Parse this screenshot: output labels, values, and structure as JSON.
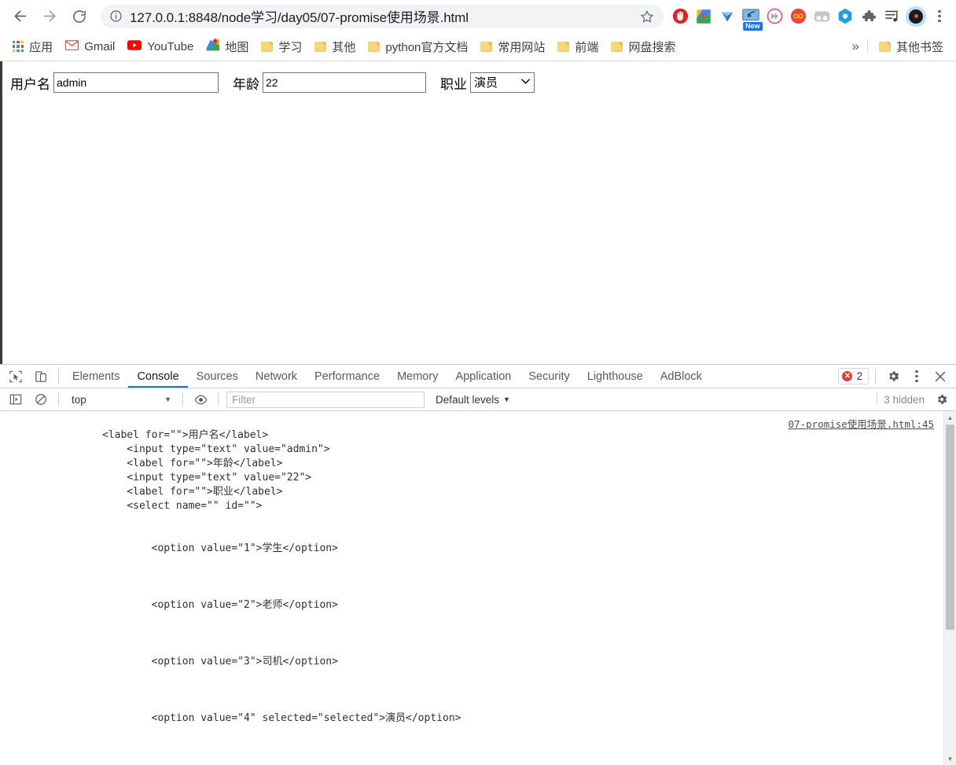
{
  "browser": {
    "nav": {
      "back": "Back",
      "forward": "Forward",
      "reload": "Reload"
    },
    "omnibox": {
      "url": "127.0.0.1:8848/node学习/day05/07-promise使用场景.html",
      "info_tooltip": "View site information",
      "star_tooltip": "Bookmark this tab"
    },
    "extensions": [
      {
        "name": "adblock-extension-icon",
        "label": "AdBlock"
      },
      {
        "name": "google-translate-extension-icon",
        "label": "Translate"
      },
      {
        "name": "v-extension-icon",
        "label": "V"
      },
      {
        "name": "screenshot-extension-icon",
        "label": "Screenshot",
        "badge": "New"
      },
      {
        "name": "fast-forward-extension-icon",
        "label": "Fast Forward"
      },
      {
        "name": "infinity-extension-icon",
        "label": "Infinity"
      },
      {
        "name": "goggles-extension-icon",
        "label": "Goggles"
      },
      {
        "name": "hexagon-extension-icon",
        "label": "Hexagon"
      },
      {
        "name": "puzzle-extensions-icon",
        "label": "Extensions"
      },
      {
        "name": "playlist-icon",
        "label": "Playlist"
      }
    ],
    "profile": {
      "name": "profile-avatar"
    },
    "menu": {
      "name": "chrome-menu-button"
    }
  },
  "bookmarks": {
    "items": [
      {
        "label": "应用",
        "icon": "apps-grid-icon"
      },
      {
        "label": "Gmail",
        "icon": "gmail-icon"
      },
      {
        "label": "YouTube",
        "icon": "youtube-icon"
      },
      {
        "label": "地图",
        "icon": "maps-icon"
      },
      {
        "label": "学习",
        "icon": "folder-icon"
      },
      {
        "label": "其他",
        "icon": "folder-icon"
      },
      {
        "label": "python官方文档",
        "icon": "folder-icon"
      },
      {
        "label": "常用网站",
        "icon": "folder-icon"
      },
      {
        "label": "前端",
        "icon": "folder-icon"
      },
      {
        "label": "网盘搜索",
        "icon": "folder-icon"
      }
    ],
    "overflow": "»",
    "other_bookmarks": {
      "label": "其他书签",
      "icon": "folder-icon"
    }
  },
  "page": {
    "form": {
      "username_label": "用户名",
      "username_value": "admin",
      "age_label": "年龄",
      "age_value": "22",
      "job_label": "职业",
      "job_selected": "演员",
      "job_options": [
        "学生",
        "老师",
        "司机",
        "演员"
      ]
    }
  },
  "devtools": {
    "tabs": [
      {
        "label": "Elements",
        "active": false
      },
      {
        "label": "Console",
        "active": true
      },
      {
        "label": "Sources",
        "active": false
      },
      {
        "label": "Network",
        "active": false
      },
      {
        "label": "Performance",
        "active": false
      },
      {
        "label": "Memory",
        "active": false
      },
      {
        "label": "Application",
        "active": false
      },
      {
        "label": "Security",
        "active": false
      },
      {
        "label": "Lighthouse",
        "active": false
      },
      {
        "label": "AdBlock",
        "active": false
      }
    ],
    "error_count": "2",
    "error_glyph": "✕",
    "console": {
      "context": "top",
      "filter_placeholder": "Filter",
      "levels": "Default levels",
      "levels_caret": "▼",
      "hidden": "3 hidden",
      "source_link": "07-promise使用场景.html:45",
      "output": "<label for=\"\">用户名</label>\n    <input type=\"text\" value=\"admin\">\n    <label for=\"\">年龄</label>\n    <input type=\"text\" value=\"22\">\n    <label for=\"\">职业</label>\n    <select name=\"\" id=\"\">\n\n\n        <option value=\"1\">学生</option>\n\n\n\n        <option value=\"2\">老师</option>\n\n\n\n        <option value=\"3\">司机</option>\n\n\n\n        <option value=\"4\" selected=\"selected\">演员</option>"
    },
    "accent_color": "#1a73e8",
    "error_color": "#e13b34"
  }
}
